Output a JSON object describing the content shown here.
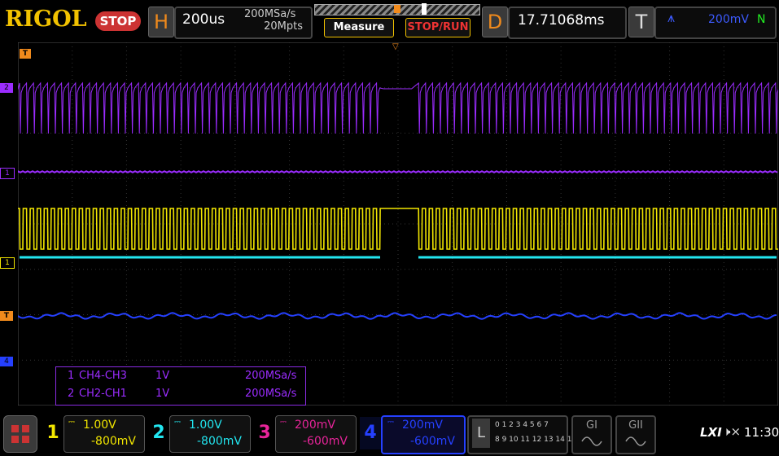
{
  "brand": "RIGOL",
  "status": "STOP",
  "horizontal": {
    "letter": "H",
    "timebase": "200us",
    "sample_rate": "200MSa/s",
    "memory_depth": "20Mpts"
  },
  "buttons": {
    "measure": "Measure",
    "stop_run": "STOP/RUN"
  },
  "delay": {
    "letter": "D",
    "value": "17.71068ms"
  },
  "trigger": {
    "letter": "T",
    "edge_icon": "rising-edge-icon",
    "level": "200mV",
    "mode": "N"
  },
  "markers": {
    "trigger_pos": "T",
    "math2": "2",
    "math1": "1",
    "ch1": "1",
    "trig_level": "T",
    "ch4": "4"
  },
  "math_panel": {
    "rows": [
      {
        "id": "1",
        "expr": "CH4-CH3",
        "scale": "1V",
        "rate": "200MSa/s"
      },
      {
        "id": "2",
        "expr": "CH2-CH1",
        "scale": "1V",
        "rate": "200MSa/s"
      }
    ]
  },
  "channels": [
    {
      "num": "1",
      "scale": "1.00V",
      "offset": "-800mV",
      "color": "#f2e600"
    },
    {
      "num": "2",
      "scale": "1.00V",
      "offset": "-800mV",
      "color": "#22e6f0"
    },
    {
      "num": "3",
      "scale": "200mV",
      "offset": "-600mV",
      "color": "#e8249a"
    },
    {
      "num": "4",
      "scale": "200mV",
      "offset": "-600mV",
      "color": "#2540ff"
    }
  ],
  "logic": {
    "letter": "L",
    "row1": "0 1 2 3  4 5 6 7",
    "row2": "8 9 10 11 12 13 14 15"
  },
  "generators": {
    "g1": "GI",
    "g2": "GII"
  },
  "footer": {
    "lxi": "LXI",
    "time": "11:30"
  },
  "colors": {
    "math": "#9b2cff",
    "ch1": "#f2e600",
    "ch2": "#22e6f0",
    "ch4": "#2540ff",
    "orange": "#f08a1c"
  }
}
